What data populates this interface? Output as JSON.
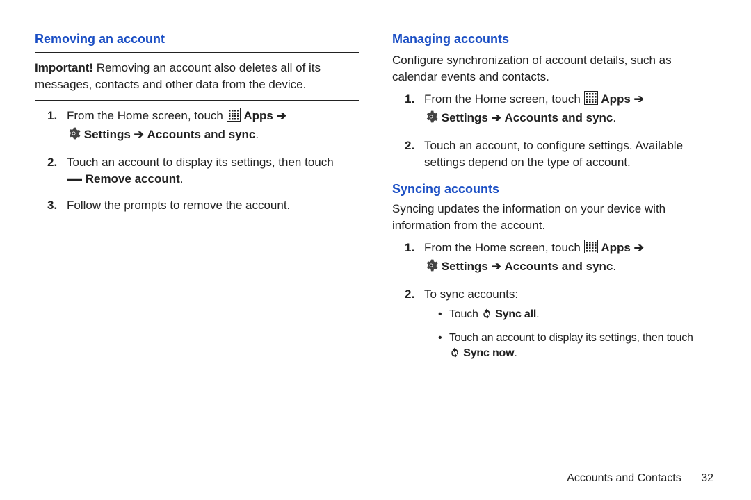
{
  "left": {
    "heading": "Removing an account",
    "important_label": "Important!",
    "important_text": "Removing an account also deletes all of its messages, contacts and other data from the device.",
    "step1_a": "From the Home screen, touch ",
    "apps": "Apps",
    "arrow": "➔",
    "settings": "Settings",
    "accounts_sync": "Accounts and sync",
    "step2": "Touch an account to display its settings, then touch",
    "remove_dash": "—",
    "remove_account": "Remove account",
    "step3": "Follow the prompts to remove the account."
  },
  "right": {
    "heading1": "Managing accounts",
    "intro1": "Configure synchronization of account details, such as calendar events and contacts.",
    "step1_a": "From the Home screen, touch ",
    "apps": "Apps",
    "arrow": "➔",
    "settings": "Settings",
    "accounts_sync": "Accounts and sync",
    "step2": "Touch an account, to configure settings. Available settings depend on the type of account.",
    "heading2": "Syncing accounts",
    "intro2": "Syncing updates the information on your device with information from the account.",
    "sync_step2_intro": "To sync accounts:",
    "bullet1_a": "Touch ",
    "sync_all": "Sync all",
    "bullet2": "Touch an account to display its settings, then touch",
    "sync_now": "Sync now"
  },
  "footer": {
    "section": "Accounts and Contacts",
    "page": "32"
  }
}
